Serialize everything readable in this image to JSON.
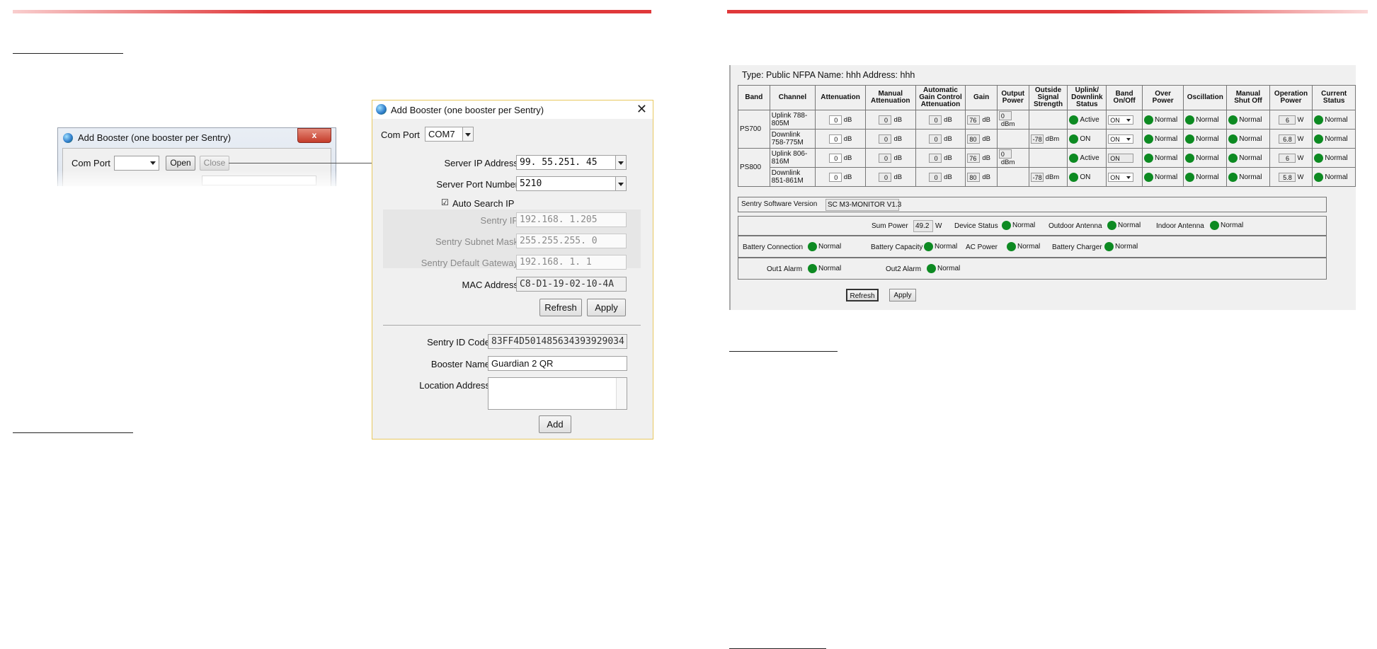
{
  "small_dialog": {
    "title": "Add Booster (one booster per Sentry)",
    "close_glyph": "x",
    "com_port_label": "Com Port",
    "com_port_value": "",
    "open_label": "Open",
    "close_label": "Close"
  },
  "dialog": {
    "title": "Add Booster (one booster per Sentry)",
    "close_glyph": "✕",
    "com_port_label": "Com Port",
    "com_port_value": "COM7",
    "server_ip_label": "Server IP Address",
    "server_ip_value": "99. 55.251. 45",
    "server_port_label": "Server Port Number",
    "server_port_value": "5210",
    "auto_search_label": "Auto Search IP",
    "auto_search_checked": true,
    "sentry_ip_label": "Sentry IP",
    "sentry_ip_value": "192.168.  1.205",
    "subnet_label": "Sentry Subnet Mask",
    "subnet_value": "255.255.255.  0",
    "gateway_label": "Sentry Default Gateway",
    "gateway_value": "192.168.  1.  1",
    "mac_label": "MAC Address",
    "mac_value": "C8-D1-19-02-10-4A",
    "refresh_label": "Refresh",
    "apply_label": "Apply",
    "sentry_id_label": "Sentry ID Code",
    "sentry_id_value": "83FF4D501485634393929034",
    "booster_name_label": "Booster Name",
    "booster_name_value": "Guardian 2 QR",
    "location_label": "Location Address",
    "location_value": "",
    "add_label": "Add"
  },
  "monitor": {
    "header": "Type: Public NFPA  Name: hhh  Address: hhh",
    "columns": [
      "Band",
      "Channel",
      "Attenuation",
      "Manual Attenuation",
      "Automatic Gain Control Attenuation",
      "Gain",
      "Output Power",
      "Outside Signal Strength",
      "Uplink/ Downlink Status",
      "Band On/Off",
      "Over Power",
      "Oscillation",
      "Manual Shut Off",
      "Operation Power",
      "Current Status"
    ],
    "bands": [
      {
        "band": "PS700",
        "rows": [
          {
            "channel": "Uplink 788-805M",
            "att": "0",
            "man_att": "0",
            "agc": "0",
            "gain": "76",
            "out_power": "0",
            "signal": "",
            "link_status": "Active",
            "on_off": "ON",
            "over_power": "Normal",
            "oscillation": "Normal",
            "shut_off": "Normal",
            "op_power": "6",
            "current": "Normal"
          },
          {
            "channel": "Downlink 758-775M",
            "att": "0",
            "man_att": "0",
            "agc": "0",
            "gain": "80",
            "out_power": "",
            "signal": "-78",
            "link_status": "ON",
            "on_off": "ON",
            "over_power": "Normal",
            "oscillation": "Normal",
            "shut_off": "Normal",
            "op_power": "6.8",
            "current": "Normal"
          }
        ]
      },
      {
        "band": "PS800",
        "rows": [
          {
            "channel": "Uplink 806-816M",
            "att": "0",
            "man_att": "0",
            "agc": "0",
            "gain": "76",
            "out_power": "0",
            "signal": "",
            "link_status": "Active",
            "on_off": "ON",
            "over_power": "Normal",
            "oscillation": "Normal",
            "shut_off": "Normal",
            "op_power": "6",
            "current": "Normal"
          },
          {
            "channel": "Downlink 851-861M",
            "att": "0",
            "man_att": "0",
            "agc": "0",
            "gain": "80",
            "out_power": "",
            "signal": "-78",
            "link_status": "ON",
            "on_off": "ON",
            "over_power": "Normal",
            "oscillation": "Normal",
            "shut_off": "Normal",
            "op_power": "5.8",
            "current": "Normal"
          }
        ]
      }
    ],
    "units": {
      "db": "dB",
      "dbm": "dBm",
      "w": "W"
    },
    "software_version_label": "Sentry Software Version",
    "software_version_value": "SC M3-MONITOR V1.3",
    "sum_power_label": "Sum Power",
    "sum_power_value": "49.2",
    "device_status_label": "Device Status",
    "outdoor_antenna_label": "Outdoor Antenna",
    "indoor_antenna_label": "Indoor Antenna",
    "battery_connection_label": "Battery Connection",
    "battery_capacity_label": "Battery Capacity",
    "ac_power_label": "AC Power",
    "battery_charger_label": "Battery Charger",
    "out1_alarm_label": "Out1 Alarm",
    "out2_alarm_label": "Out2 Alarm",
    "status_normal": "Normal",
    "refresh_label": "Refresh",
    "apply_label": "Apply"
  },
  "colors": {
    "accent_red": "#e0383a",
    "status_green": "#0d8a22"
  }
}
